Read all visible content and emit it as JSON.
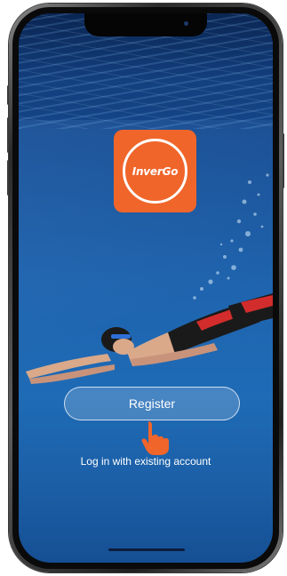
{
  "app": {
    "logo_text": "InverGo",
    "brand_color": "#f0652a"
  },
  "actions": {
    "register_label": "Register",
    "login_label": "Log in with existing account"
  },
  "icons": {
    "pointer": "hand-pointer-icon"
  },
  "colors": {
    "screen_background": "#1f63ad",
    "button_border": "#ffffff",
    "pointer_color": "#f0652a"
  }
}
